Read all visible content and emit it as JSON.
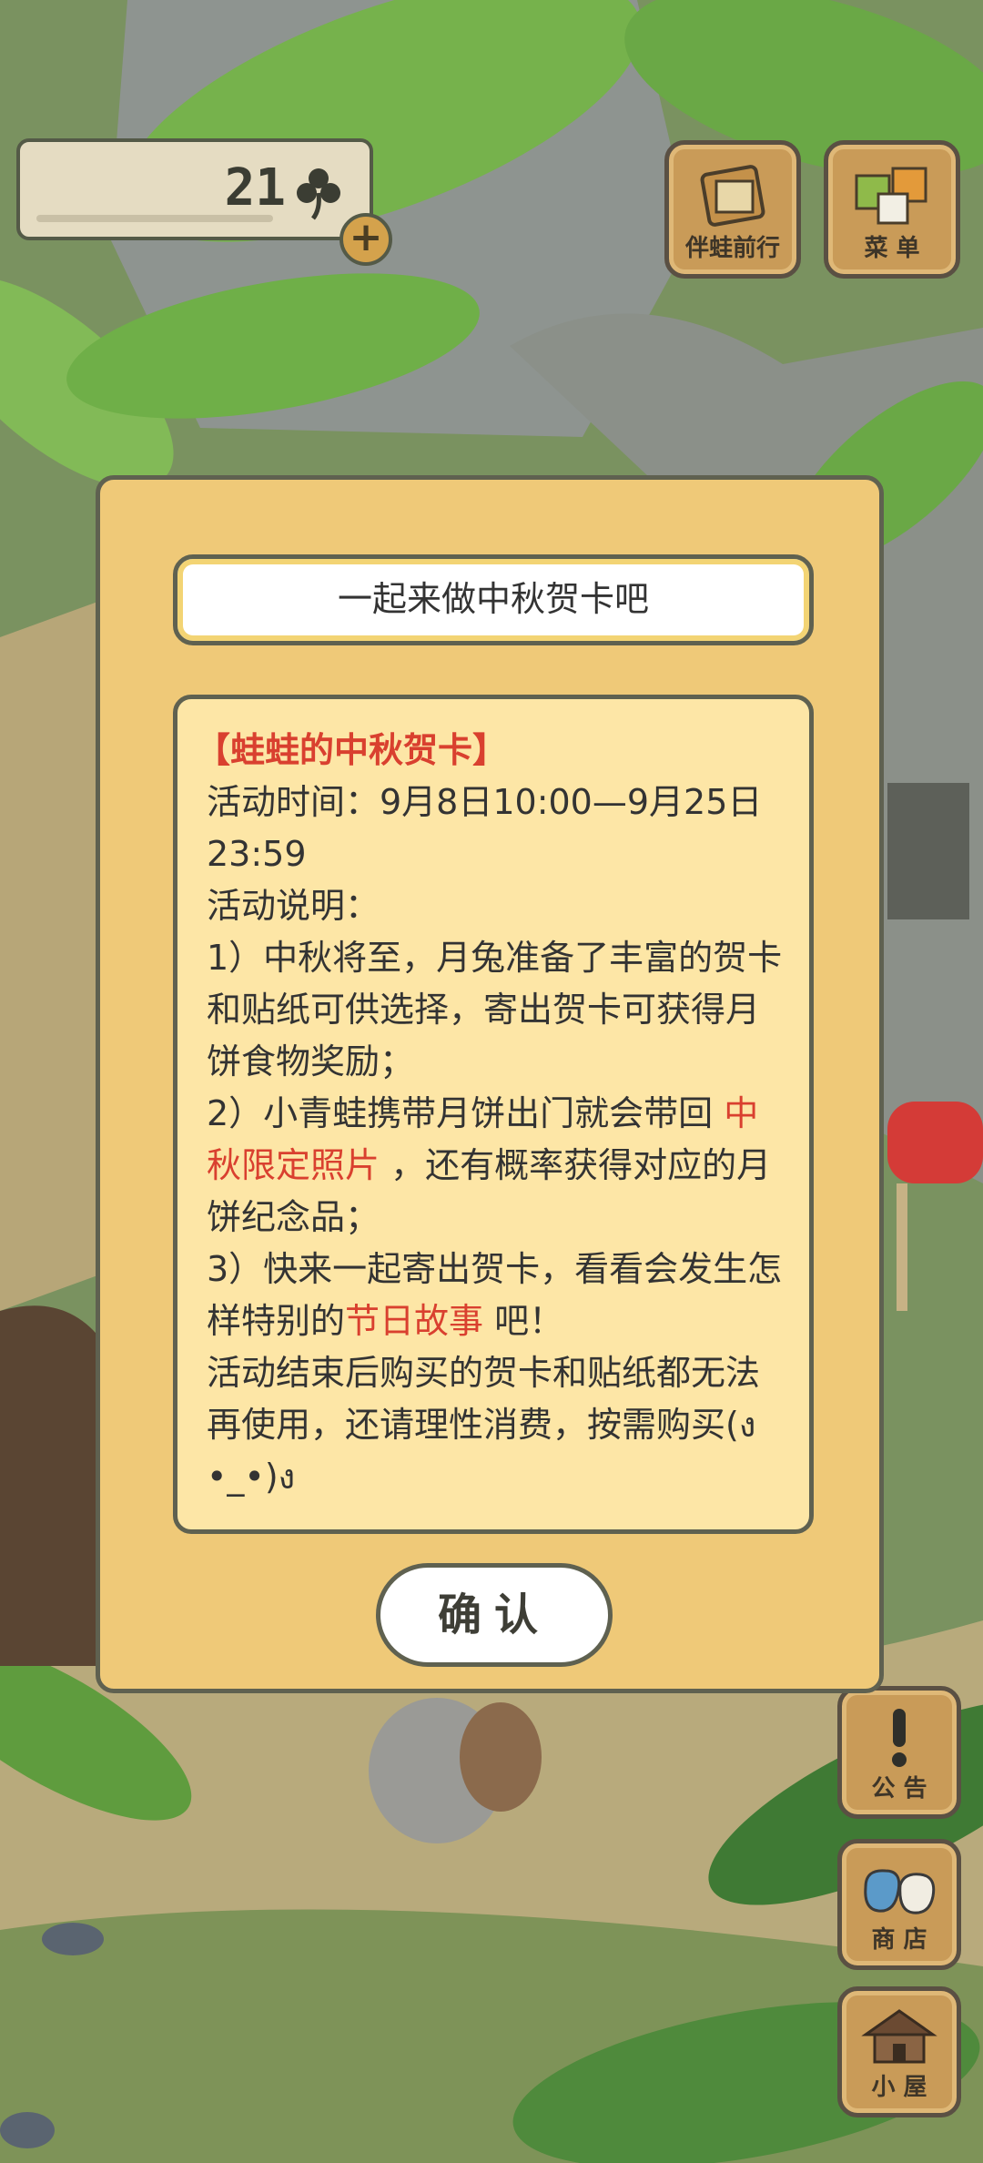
{
  "clover": {
    "count": "21"
  },
  "top_buttons": {
    "travel_label": "伴蛙前行",
    "menu_label": "菜 单"
  },
  "side_buttons": {
    "notice_label": "公 告",
    "shop_label": "商 店",
    "house_label": "小 屋"
  },
  "dialog": {
    "title": "一起来做中秋贺卡吧",
    "headline": "【蛙蛙的中秋贺卡】",
    "time_line": "活动时间：9月8日10:00—9月25日23:59",
    "desc_label": "活动说明：",
    "item1": "1）中秋将至，月兔准备了丰富的贺卡和贴纸可供选择，寄出贺卡可获得月饼食物奖励；",
    "item2_pre": "2）小青蛙携带月饼出门就会带回",
    "item2_hl": "中秋限定照片",
    "item2_post": "，还有概率获得对应的月饼纪念品；",
    "item3_pre": "3）快来一起寄出贺卡，看看会发生怎样特别的",
    "item3_hl": "节日故事",
    "item3_post": "吧！",
    "notice": "活动结束后购买的贺卡和贴纸都无法再使用，还请理性消费，按需购买(ง •_•)ง",
    "confirm_label": "确认"
  },
  "colors": {
    "dialog_bg": "#efc978",
    "body_bg": "#fde6a6",
    "highlight": "#d9402f",
    "border": "#5f6150"
  }
}
